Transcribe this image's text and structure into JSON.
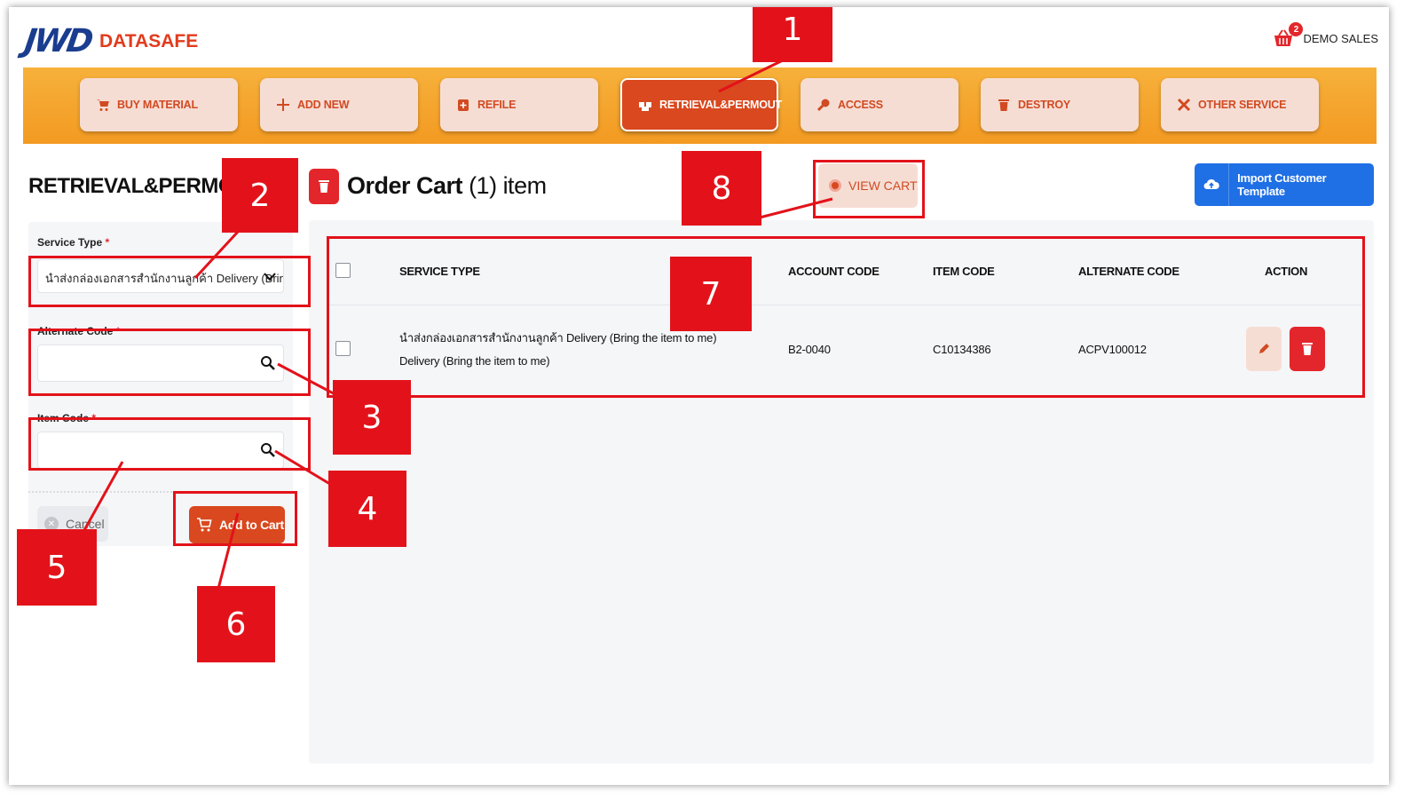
{
  "header": {
    "logo_mark": "JWD",
    "logo_text": "DATASAFE",
    "cart_count": "2",
    "user_name": "DEMO SALES"
  },
  "menu": [
    {
      "label": "BUY MATERIAL",
      "icon": "cart-icon"
    },
    {
      "label": "ADD NEW",
      "icon": "plus-icon"
    },
    {
      "label": "REFILE",
      "icon": "file-plus-icon"
    },
    {
      "label": "RETRIEVAL&PERMOUT",
      "icon": "boxes-icon",
      "active": true
    },
    {
      "label": "ACCESS",
      "icon": "key-icon"
    },
    {
      "label": "DESTROY",
      "icon": "trash-icon"
    },
    {
      "label": "OTHER SERVICE",
      "icon": "tools-icon"
    }
  ],
  "left": {
    "page_title": "RETRIEVAL&PERMOUT",
    "service_type_label": "Service Type",
    "service_type_value": "นำส่งกล่องเอกสารสำนักงานลูกค้า Delivery (Bring the item to me)",
    "alternate_code_label": "Alternate Code",
    "item_code_label": "Item Code",
    "required_mark": "*",
    "cancel_label": "Cancel",
    "add_to_cart_label": "Add to Cart"
  },
  "cart": {
    "title_bold": "Order Cart",
    "title_count": "(1) item",
    "view_cart_label": "VIEW CART",
    "import_label": "Import Customer Template",
    "columns": [
      "SERVICE TYPE",
      "ACCOUNT CODE",
      "ITEM CODE",
      "ALTERNATE CODE",
      "ACTION"
    ],
    "rows": [
      {
        "service_type": "นำส่งกล่องเอกสารสำนักงานลูกค้า Delivery (Bring the item to me) Delivery (Bring the item to me)",
        "account_code": "B2-0040",
        "item_code": "C10134386",
        "alternate_code": "ACPV100012"
      }
    ]
  },
  "annotations": [
    "1",
    "2",
    "3",
    "4",
    "5",
    "6",
    "7",
    "8"
  ],
  "colors": {
    "brand_blue": "#1a3d8f",
    "brand_orange": "#d9481f",
    "menu_bar": "#f39a22",
    "annotation_red": "#e3121a",
    "import_blue": "#1f6fe5"
  }
}
